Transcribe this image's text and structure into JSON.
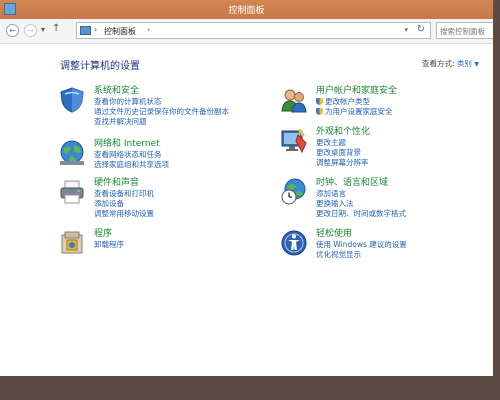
{
  "window": {
    "title": "控制面板"
  },
  "toolbar": {
    "back_glyph": "←",
    "forward_glyph": "→",
    "up_glyph": "↑",
    "breadcrumb": "控制面板",
    "search_placeholder": "搜索控制面板"
  },
  "main": {
    "title": "调整计算机的设置",
    "view_by_label": "查看方式:",
    "view_by_value": "类别"
  },
  "categories": [
    {
      "icon": "shield-icon",
      "heading": "系统和安全",
      "links": [
        "查看你的计算机状态",
        "通过文件历史记录保存你的文件备份副本",
        "查找并解决问题"
      ]
    },
    {
      "icon": "network-globe-icon",
      "heading": "网络和 Internet",
      "links": [
        "查看网络状态和任务",
        "选择家庭组和共享选项"
      ]
    },
    {
      "icon": "printer-icon",
      "heading": "硬件和声音",
      "links": [
        "查看设备和打印机",
        "添加设备",
        "调整常用移动设置"
      ]
    },
    {
      "icon": "programs-icon",
      "heading": "程序",
      "links": [
        "卸载程序"
      ]
    },
    {
      "icon": "users-icon",
      "heading": "用户帐户和家庭安全",
      "links": [
        "更改帐户类型",
        "为用户设置家庭安全"
      ]
    },
    {
      "icon": "personalization-icon",
      "heading": "外观和个性化",
      "links": [
        "更改主题",
        "更改桌面背景",
        "调整屏幕分辨率"
      ]
    },
    {
      "icon": "clock-globe-icon",
      "heading": "时钟、语言和区域",
      "links": [
        "添加语言",
        "更换输入法",
        "更改日期、时间或数字格式"
      ]
    },
    {
      "icon": "ease-of-access-icon",
      "heading": "轻松使用",
      "links": [
        "使用 Windows 建议的设置",
        "优化视觉显示"
      ]
    }
  ]
}
